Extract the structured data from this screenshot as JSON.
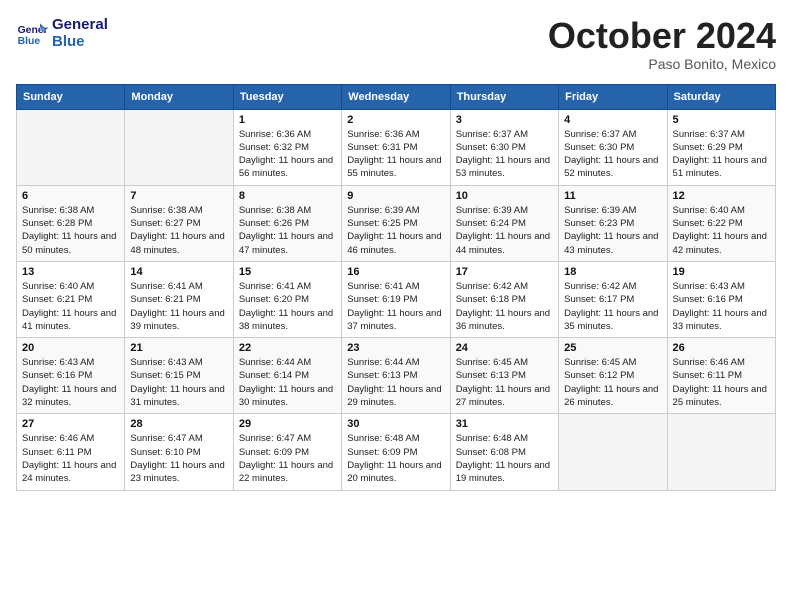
{
  "header": {
    "logo_line1": "General",
    "logo_line2": "Blue",
    "month": "October 2024",
    "location": "Paso Bonito, Mexico"
  },
  "weekdays": [
    "Sunday",
    "Monday",
    "Tuesday",
    "Wednesday",
    "Thursday",
    "Friday",
    "Saturday"
  ],
  "weeks": [
    [
      {
        "day": "",
        "info": ""
      },
      {
        "day": "",
        "info": ""
      },
      {
        "day": "1",
        "info": "Sunrise: 6:36 AM\nSunset: 6:32 PM\nDaylight: 11 hours and 56 minutes."
      },
      {
        "day": "2",
        "info": "Sunrise: 6:36 AM\nSunset: 6:31 PM\nDaylight: 11 hours and 55 minutes."
      },
      {
        "day": "3",
        "info": "Sunrise: 6:37 AM\nSunset: 6:30 PM\nDaylight: 11 hours and 53 minutes."
      },
      {
        "day": "4",
        "info": "Sunrise: 6:37 AM\nSunset: 6:30 PM\nDaylight: 11 hours and 52 minutes."
      },
      {
        "day": "5",
        "info": "Sunrise: 6:37 AM\nSunset: 6:29 PM\nDaylight: 11 hours and 51 minutes."
      }
    ],
    [
      {
        "day": "6",
        "info": "Sunrise: 6:38 AM\nSunset: 6:28 PM\nDaylight: 11 hours and 50 minutes."
      },
      {
        "day": "7",
        "info": "Sunrise: 6:38 AM\nSunset: 6:27 PM\nDaylight: 11 hours and 48 minutes."
      },
      {
        "day": "8",
        "info": "Sunrise: 6:38 AM\nSunset: 6:26 PM\nDaylight: 11 hours and 47 minutes."
      },
      {
        "day": "9",
        "info": "Sunrise: 6:39 AM\nSunset: 6:25 PM\nDaylight: 11 hours and 46 minutes."
      },
      {
        "day": "10",
        "info": "Sunrise: 6:39 AM\nSunset: 6:24 PM\nDaylight: 11 hours and 44 minutes."
      },
      {
        "day": "11",
        "info": "Sunrise: 6:39 AM\nSunset: 6:23 PM\nDaylight: 11 hours and 43 minutes."
      },
      {
        "day": "12",
        "info": "Sunrise: 6:40 AM\nSunset: 6:22 PM\nDaylight: 11 hours and 42 minutes."
      }
    ],
    [
      {
        "day": "13",
        "info": "Sunrise: 6:40 AM\nSunset: 6:21 PM\nDaylight: 11 hours and 41 minutes."
      },
      {
        "day": "14",
        "info": "Sunrise: 6:41 AM\nSunset: 6:21 PM\nDaylight: 11 hours and 39 minutes."
      },
      {
        "day": "15",
        "info": "Sunrise: 6:41 AM\nSunset: 6:20 PM\nDaylight: 11 hours and 38 minutes."
      },
      {
        "day": "16",
        "info": "Sunrise: 6:41 AM\nSunset: 6:19 PM\nDaylight: 11 hours and 37 minutes."
      },
      {
        "day": "17",
        "info": "Sunrise: 6:42 AM\nSunset: 6:18 PM\nDaylight: 11 hours and 36 minutes."
      },
      {
        "day": "18",
        "info": "Sunrise: 6:42 AM\nSunset: 6:17 PM\nDaylight: 11 hours and 35 minutes."
      },
      {
        "day": "19",
        "info": "Sunrise: 6:43 AM\nSunset: 6:16 PM\nDaylight: 11 hours and 33 minutes."
      }
    ],
    [
      {
        "day": "20",
        "info": "Sunrise: 6:43 AM\nSunset: 6:16 PM\nDaylight: 11 hours and 32 minutes."
      },
      {
        "day": "21",
        "info": "Sunrise: 6:43 AM\nSunset: 6:15 PM\nDaylight: 11 hours and 31 minutes."
      },
      {
        "day": "22",
        "info": "Sunrise: 6:44 AM\nSunset: 6:14 PM\nDaylight: 11 hours and 30 minutes."
      },
      {
        "day": "23",
        "info": "Sunrise: 6:44 AM\nSunset: 6:13 PM\nDaylight: 11 hours and 29 minutes."
      },
      {
        "day": "24",
        "info": "Sunrise: 6:45 AM\nSunset: 6:13 PM\nDaylight: 11 hours and 27 minutes."
      },
      {
        "day": "25",
        "info": "Sunrise: 6:45 AM\nSunset: 6:12 PM\nDaylight: 11 hours and 26 minutes."
      },
      {
        "day": "26",
        "info": "Sunrise: 6:46 AM\nSunset: 6:11 PM\nDaylight: 11 hours and 25 minutes."
      }
    ],
    [
      {
        "day": "27",
        "info": "Sunrise: 6:46 AM\nSunset: 6:11 PM\nDaylight: 11 hours and 24 minutes."
      },
      {
        "day": "28",
        "info": "Sunrise: 6:47 AM\nSunset: 6:10 PM\nDaylight: 11 hours and 23 minutes."
      },
      {
        "day": "29",
        "info": "Sunrise: 6:47 AM\nSunset: 6:09 PM\nDaylight: 11 hours and 22 minutes."
      },
      {
        "day": "30",
        "info": "Sunrise: 6:48 AM\nSunset: 6:09 PM\nDaylight: 11 hours and 20 minutes."
      },
      {
        "day": "31",
        "info": "Sunrise: 6:48 AM\nSunset: 6:08 PM\nDaylight: 11 hours and 19 minutes."
      },
      {
        "day": "",
        "info": ""
      },
      {
        "day": "",
        "info": ""
      }
    ]
  ]
}
